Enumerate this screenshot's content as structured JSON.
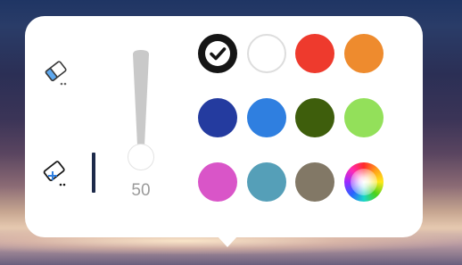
{
  "colors": {
    "panel_bg": "#ffffff",
    "selected_tool_indicator": "#1d2a4a",
    "slider_fill": "#c9c9c9",
    "slider_value_text": "#9b9b9b"
  },
  "tools": [
    {
      "name": "eraser",
      "icon": "eraser-icon",
      "selected": false
    },
    {
      "name": "shape-eraser",
      "icon": "eraser-plus-icon",
      "selected": true
    }
  ],
  "size_slider": {
    "value": "50",
    "level_fraction": 0.5
  },
  "palette": {
    "selected_index": 0,
    "swatches": [
      {
        "color": "#151515",
        "icon": "checkmark-icon"
      },
      {
        "color": "#ffffff"
      },
      {
        "color": "#ee3a2d"
      },
      {
        "color": "#ee8b2e"
      },
      {
        "color": "#243b9f"
      },
      {
        "color": "#2f7fe0"
      },
      {
        "color": "#3e5e0c"
      },
      {
        "color": "#93e05a"
      },
      {
        "color": "#d955c8"
      },
      {
        "color": "#559fb8"
      },
      {
        "color": "#827866"
      },
      {
        "color": "rainbow",
        "icon": "color-wheel-icon"
      }
    ]
  }
}
